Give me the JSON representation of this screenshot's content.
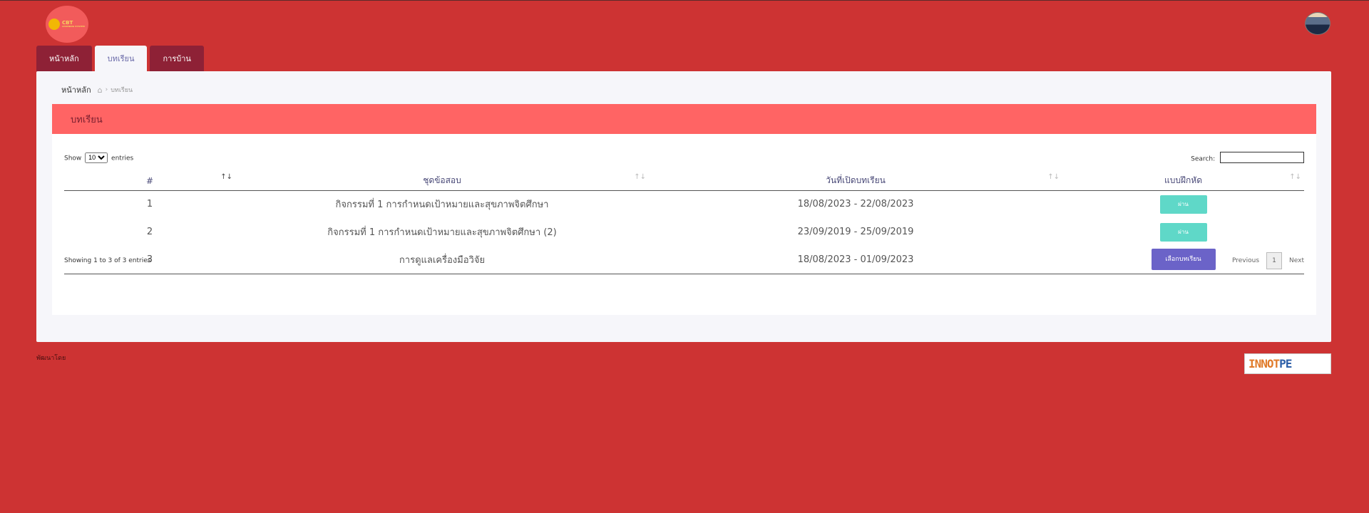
{
  "header": {
    "logo_text": "CBT",
    "logo_sub": "LEARNING SYSTEM"
  },
  "tabs": [
    {
      "label": "หน้าหลัก",
      "active": false
    },
    {
      "label": "บทเรียน",
      "active": true
    },
    {
      "label": "การบ้าน",
      "active": false
    }
  ],
  "breadcrumb": {
    "root": "หน้าหลัก",
    "current": "บทเรียน"
  },
  "card": {
    "title": "บทเรียน"
  },
  "controls": {
    "show_label": "Show",
    "entries_value": "10",
    "entries_label": "entries",
    "search_label": "Search:",
    "search_value": ""
  },
  "table": {
    "columns": [
      "#",
      "ชุดข้อสอบ",
      "วันที่เปิดบทเรียน",
      "แบบฝึกหัด"
    ],
    "rows": [
      {
        "num": "1",
        "name": "กิจกรรมที่ 1 การกำหนดเป้าหมายและสุขภาพจิตศึกษา",
        "dates": "18/08/2023 - 22/08/2023",
        "action": "ผ่าน"
      },
      {
        "num": "2",
        "name": "กิจกรรมที่ 1 การกำหนดเป้าหมายและสุขภาพจิตศึกษา (2)",
        "dates": "23/09/2019 - 25/09/2019",
        "action": "ผ่าน"
      },
      {
        "num": "3",
        "name": "การดูแลเครื่องมือวิจัย",
        "dates": "18/08/2023 - 01/09/2023",
        "action": "เลือกบทเรียน"
      }
    ]
  },
  "pagination": {
    "info": "Showing 1 to 3 of 3 entries",
    "previous": "Previous",
    "page": "1",
    "next": "Next"
  },
  "footer": {
    "text": "พัฒนาโดย",
    "partner_a": "INNOT",
    "partner_b": "PE"
  },
  "colors": {
    "background": "#cd3333",
    "header_bar": "#ff6464",
    "tab": "#8e2136",
    "pass_button": "#5fd8c8",
    "choose_button": "#6b63c8"
  }
}
